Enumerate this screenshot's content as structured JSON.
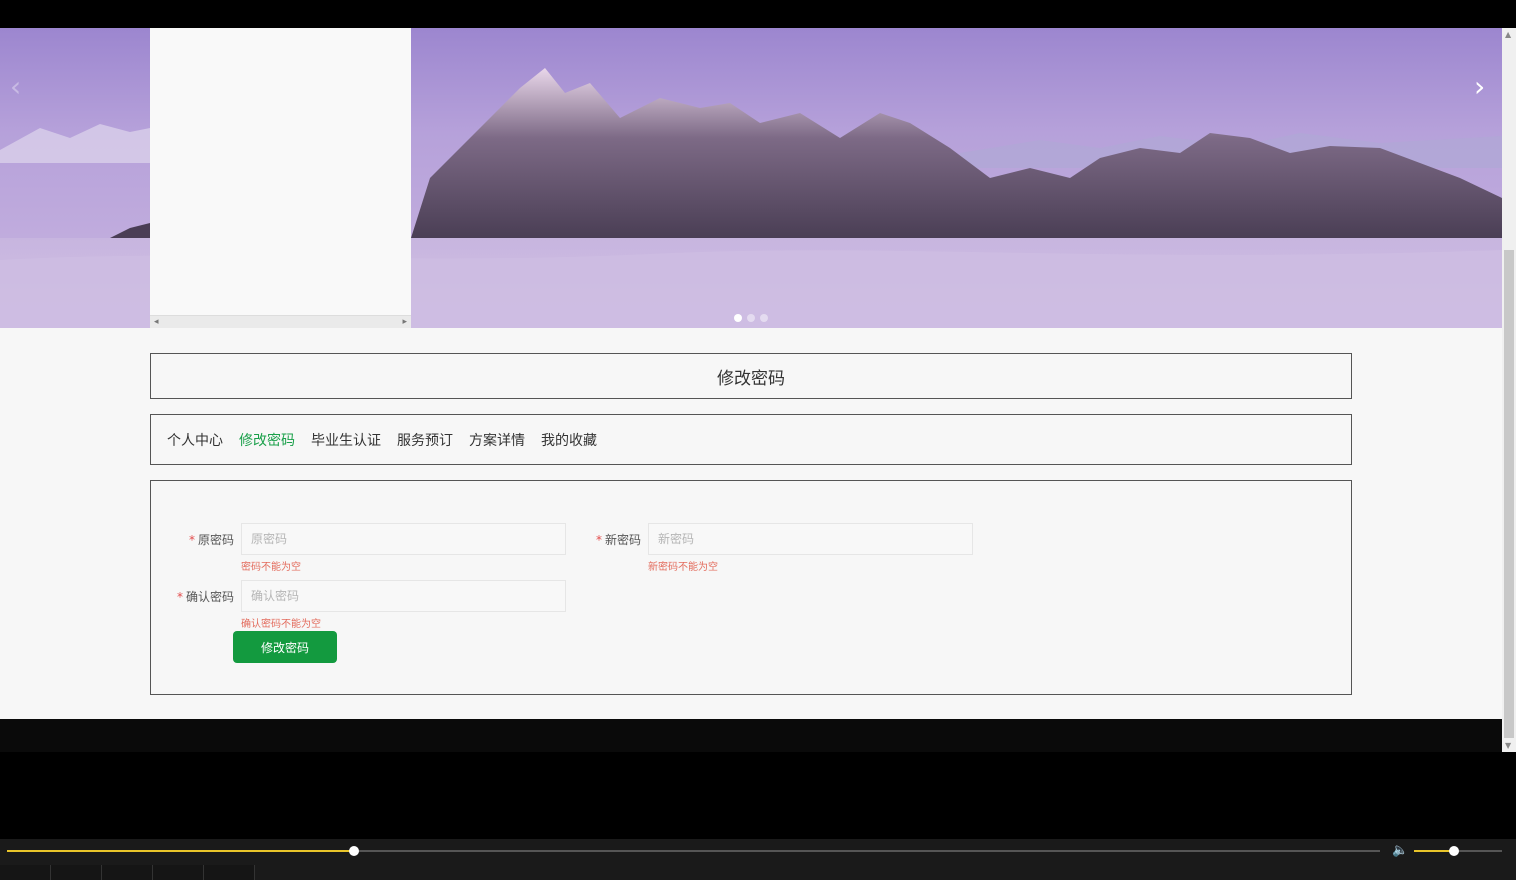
{
  "banner": {
    "prev_icon": "chevron-left-icon",
    "next_icon": "chevron-right-icon",
    "prev_glyph": "‹",
    "next_glyph": "›",
    "slides": 3,
    "active_slide": 1
  },
  "page_title": "修改密码",
  "nav": {
    "items": [
      {
        "label": "个人中心",
        "active": false
      },
      {
        "label": "修改密码",
        "active": true
      },
      {
        "label": "毕业生认证",
        "active": false
      },
      {
        "label": "服务预订",
        "active": false
      },
      {
        "label": "方案详情",
        "active": false
      },
      {
        "label": "我的收藏",
        "active": false
      }
    ]
  },
  "form": {
    "required_mark": "*",
    "old_password": {
      "label": "原密码",
      "placeholder": "原密码",
      "error": "密码不能为空"
    },
    "new_password": {
      "label": "新密码",
      "placeholder": "新密码",
      "error": "新密码不能为空"
    },
    "confirm_password": {
      "label": "确认密码",
      "placeholder": "确认密码",
      "error": "确认密码不能为空"
    },
    "submit_label": "修改密码"
  },
  "player": {
    "progress": 0.253,
    "volume": 0.45,
    "accent_color": "#e8c42a",
    "volume_icon": "speaker-icon"
  },
  "colors": {
    "accent_green": "#139a3f",
    "active_nav": "#1aa04a",
    "error_red": "#e36c5d"
  }
}
